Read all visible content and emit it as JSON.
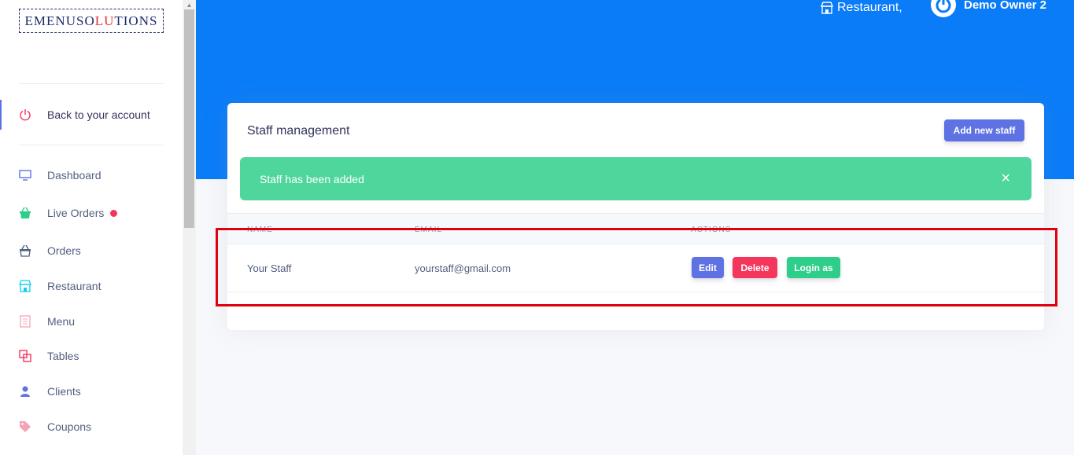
{
  "logo": {
    "part1": "EMENUSO",
    "part2": "LU",
    "part3": "TIONS"
  },
  "sidebar": {
    "back": "Back to your account",
    "items": [
      {
        "label": "Dashboard",
        "icon": "monitor-icon",
        "color": "#5e72e4"
      },
      {
        "label": "Live Orders",
        "icon": "basket-icon",
        "color": "#2dce89"
      },
      {
        "label": "Orders",
        "icon": "basket-icon",
        "color": "#525f7f"
      },
      {
        "label": "Restaurant",
        "icon": "shop-icon",
        "color": "#11cdef"
      },
      {
        "label": "Menu",
        "icon": "menu-book-icon",
        "color": "#f3a4b5"
      },
      {
        "label": "Tables",
        "icon": "tables-icon",
        "color": "#f5365c"
      },
      {
        "label": "Clients",
        "icon": "user-icon",
        "color": "#5e72e4"
      },
      {
        "label": "Coupons",
        "icon": "tag-icon",
        "color": "#f3a4b5"
      }
    ]
  },
  "topbar": {
    "restaurant": "Restaurant,",
    "user": "Demo Owner 2"
  },
  "card": {
    "title": "Staff management",
    "add_button": "Add new staff",
    "alert": "Staff has been added",
    "alert_close": "×",
    "columns": [
      "Name",
      "Email",
      "Actions"
    ],
    "rows": [
      {
        "name": "Your Staff",
        "email": "yourstaff@gmail.com"
      }
    ],
    "actions": {
      "edit": "Edit",
      "delete": "Delete",
      "login": "Login as"
    }
  },
  "colors": {
    "header": "#0a7cf8",
    "primary": "#5e72e4",
    "danger": "#f5365c",
    "success": "#2dce89",
    "alert": "#4fd69c"
  }
}
